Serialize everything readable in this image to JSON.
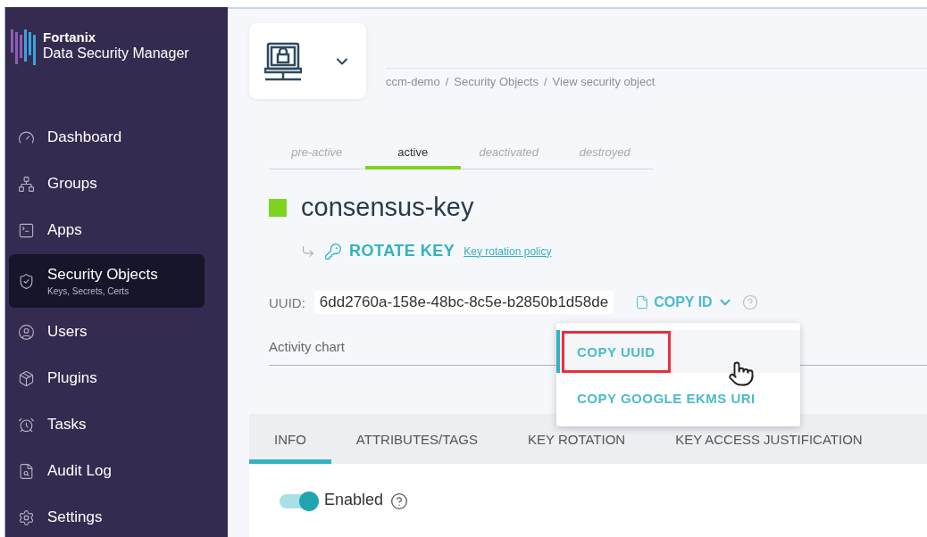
{
  "brand": {
    "name": "Fortanix",
    "product": "Data Security Manager"
  },
  "sidebar": {
    "items": [
      {
        "label": "Dashboard",
        "selected": false
      },
      {
        "label": "Groups",
        "selected": false
      },
      {
        "label": "Apps",
        "selected": false
      },
      {
        "label": "Security Objects",
        "subtitle": "Keys, Secrets, Certs",
        "selected": true
      },
      {
        "label": "Users",
        "selected": false
      },
      {
        "label": "Plugins",
        "selected": false
      },
      {
        "label": "Tasks",
        "selected": false
      },
      {
        "label": "Audit Log",
        "selected": false
      },
      {
        "label": "Settings",
        "selected": false
      }
    ]
  },
  "breadcrumb": [
    "ccm-demo",
    "Security Objects",
    "View security object"
  ],
  "breadcrumb_separator": "/",
  "lifecycle_tabs": [
    {
      "label": "pre-active",
      "selected": false
    },
    {
      "label": "active",
      "selected": true
    },
    {
      "label": "deactivated",
      "selected": false
    },
    {
      "label": "destroyed",
      "selected": false
    }
  ],
  "key": {
    "name": "consensus-key",
    "color": "#7ed321",
    "rotate_label": "ROTATE KEY",
    "policy_link": "Key rotation policy"
  },
  "uuid": {
    "label": "UUID:",
    "value": "6dd2760a-158e-48bc-8c5e-b2850b1d58de",
    "copy_label": "COPY ID",
    "expanded": true
  },
  "copy_menu": [
    {
      "label": "COPY UUID",
      "selected": true
    },
    {
      "label": "COPY GOOGLE EKMS URI",
      "selected": false
    }
  ],
  "activity_chart": {
    "title": "Activity chart"
  },
  "detail_tabs": [
    {
      "label": "INFO",
      "selected": true
    },
    {
      "label": "ATTRIBUTES/TAGS",
      "selected": false
    },
    {
      "label": "KEY ROTATION",
      "selected": false
    },
    {
      "label": "KEY ACCESS JUSTIFICATION",
      "selected": false
    }
  ],
  "enabled": {
    "label": "Enabled",
    "on": true
  }
}
